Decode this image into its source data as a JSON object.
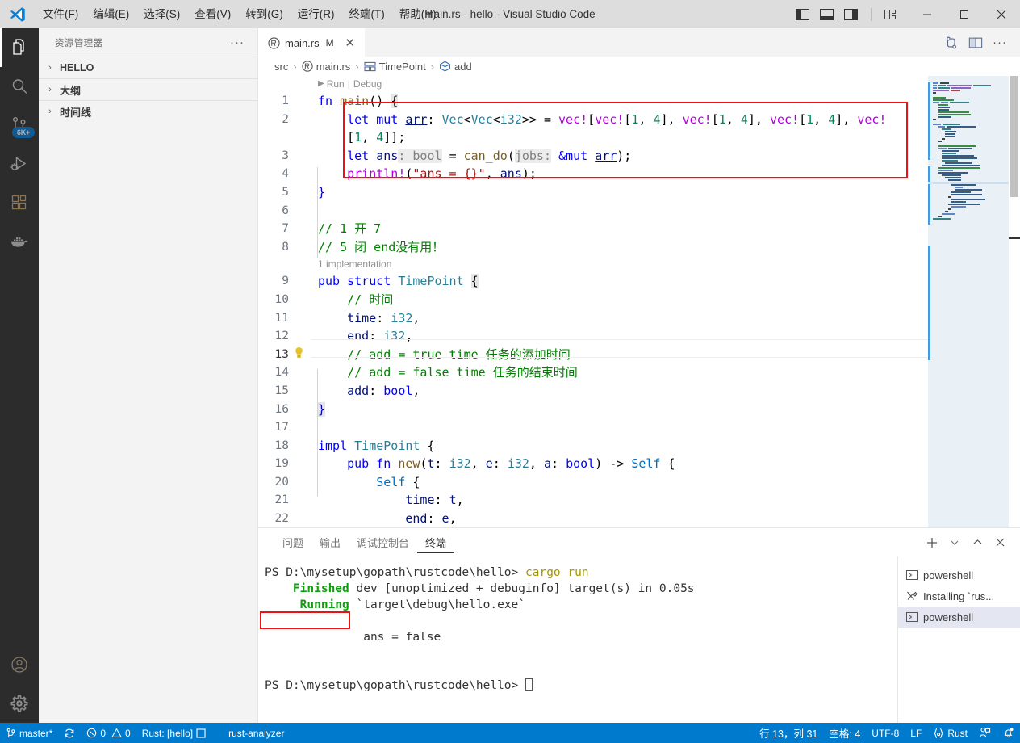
{
  "window": {
    "title": "main.rs - hello - Visual Studio Code",
    "logo_icon": "vscode-logo-icon",
    "menu": [
      {
        "label": "文件(F)",
        "name": "menu-file"
      },
      {
        "label": "编辑(E)",
        "name": "menu-edit"
      },
      {
        "label": "选择(S)",
        "name": "menu-selection"
      },
      {
        "label": "查看(V)",
        "name": "menu-view"
      },
      {
        "label": "转到(G)",
        "name": "menu-go"
      },
      {
        "label": "运行(R)",
        "name": "menu-run"
      },
      {
        "label": "终端(T)",
        "name": "menu-terminal"
      },
      {
        "label": "帮助(H)",
        "name": "menu-help"
      }
    ],
    "layout_buttons": [
      {
        "name": "toggle-primary-sidebar-icon",
        "title": "切换主侧栏"
      },
      {
        "name": "toggle-panel-icon",
        "title": "切换面板"
      },
      {
        "name": "toggle-secondary-sidebar-icon",
        "title": "切换辅助侧栏"
      },
      {
        "name": "customize-layout-icon",
        "title": "自定义布局"
      }
    ],
    "controls": [
      {
        "name": "minimize-button",
        "glyph": "—"
      },
      {
        "name": "maximize-button",
        "glyph": "□"
      },
      {
        "name": "close-button",
        "glyph": "✕"
      }
    ]
  },
  "activitybar": {
    "items": [
      {
        "name": "activity-explorer",
        "icon": "files-icon",
        "active": true,
        "badge": ""
      },
      {
        "name": "activity-search",
        "icon": "search-icon",
        "active": false,
        "badge": ""
      },
      {
        "name": "activity-source-control",
        "icon": "source-control-icon",
        "active": false,
        "badge": "6K+"
      },
      {
        "name": "activity-run-debug",
        "icon": "run-debug-icon",
        "active": false,
        "badge": ""
      },
      {
        "name": "activity-extensions",
        "icon": "extensions-icon",
        "active": false,
        "badge": ""
      },
      {
        "name": "activity-docker",
        "icon": "docker-icon",
        "active": false,
        "badge": ""
      }
    ],
    "bottom": [
      {
        "name": "activity-accounts",
        "icon": "account-icon"
      },
      {
        "name": "activity-settings",
        "icon": "gear-icon"
      }
    ]
  },
  "sidebar": {
    "title": "资源管理器",
    "more_label": "···",
    "sections": [
      {
        "name": "sidebar-section-hello",
        "label": "HELLO",
        "chevron": "›",
        "expanded": false
      },
      {
        "name": "sidebar-section-outline",
        "label": "大纲",
        "chevron": "›",
        "expanded": false
      },
      {
        "name": "sidebar-section-timeline",
        "label": "时间线",
        "chevron": "›",
        "expanded": false
      }
    ]
  },
  "tabs": {
    "items": [
      {
        "name": "tab-main-rs",
        "label": "main.rs",
        "modified": "M",
        "close": "✕",
        "icon": "rust-file-icon",
        "active": true
      }
    ],
    "actions": [
      {
        "name": "source-control-graph-icon"
      },
      {
        "name": "split-editor-icon"
      },
      {
        "name": "more-actions-icon",
        "glyph": "···"
      }
    ]
  },
  "breadcrumb": {
    "items": [
      {
        "name": "breadcrumb-src",
        "label": "src",
        "icon": ""
      },
      {
        "name": "breadcrumb-main-rs",
        "label": "main.rs",
        "icon": "rust-file-icon"
      },
      {
        "name": "breadcrumb-timepoint",
        "label": "TimePoint",
        "icon": "struct-icon"
      },
      {
        "name": "breadcrumb-add",
        "label": "add",
        "icon": "field-icon"
      }
    ],
    "separator": "›"
  },
  "editor": {
    "codelens": {
      "run": "Run",
      "sep": "|",
      "debug": "Debug",
      "triangle": "▶"
    },
    "implementation_lens": "1 implementation",
    "lightbulb_line": 13,
    "lines": [
      {
        "n": 1,
        "text": "fn main() {"
      },
      {
        "n": 2,
        "text": "    let mut arr: Vec<Vec<i32>> = vec![vec![1, 4], vec![1, 4], vec![1, 4], vec!"
      },
      {
        "n": "",
        "text": "    [1, 4]];"
      },
      {
        "n": 3,
        "text": "    let ans: bool = can_do(jobs: &mut arr);"
      },
      {
        "n": 4,
        "text": "    println!(\"ans = {}\", ans);"
      },
      {
        "n": 5,
        "text": "}"
      },
      {
        "n": 6,
        "text": ""
      },
      {
        "n": 7,
        "text": "// 1 开 7"
      },
      {
        "n": 8,
        "text": "// 5 闭 end没有用！"
      },
      {
        "n": 9,
        "text": "pub struct TimePoint {"
      },
      {
        "n": 10,
        "text": "    // 时间"
      },
      {
        "n": 11,
        "text": "    time: i32,"
      },
      {
        "n": 12,
        "text": "    end: i32,"
      },
      {
        "n": 13,
        "text": "    // add = true time 任务的添加时间"
      },
      {
        "n": 14,
        "text": "    // add = false time 任务的结束时间"
      },
      {
        "n": 15,
        "text": "    add: bool,"
      },
      {
        "n": 16,
        "text": "}"
      },
      {
        "n": 17,
        "text": ""
      },
      {
        "n": 18,
        "text": "impl TimePoint {"
      },
      {
        "n": 19,
        "text": "    pub fn new(t: i32, e: i32, a: bool) -> Self {"
      },
      {
        "n": 20,
        "text": "        Self {"
      },
      {
        "n": 21,
        "text": "            time: t,"
      },
      {
        "n": 22,
        "text": "            end: e,"
      }
    ]
  },
  "panel": {
    "tabs": [
      {
        "name": "panel-tab-problems",
        "label": "问题",
        "active": false
      },
      {
        "name": "panel-tab-output",
        "label": "输出",
        "active": false
      },
      {
        "name": "panel-tab-debug-console",
        "label": "调试控制台",
        "active": false
      },
      {
        "name": "panel-tab-terminal",
        "label": "终端",
        "active": true
      }
    ],
    "actions": [
      {
        "name": "new-terminal-button",
        "glyph": "+"
      },
      {
        "name": "terminal-profile-chevron-icon",
        "glyph": "∨"
      },
      {
        "name": "maximize-panel-icon",
        "glyph": "∧"
      },
      {
        "name": "close-panel-icon",
        "glyph": "✕"
      }
    ],
    "terminal": {
      "prompt": "PS D:\\mysetup\\gopath\\rustcode\\hello>",
      "command": "cargo run",
      "lines": [
        {
          "label": "Finished",
          "rest": " dev [unoptimized + debuginfo] target(s) in 0.05s"
        },
        {
          "label": "Running",
          "rest": " `target\\debug\\hello.exe`"
        }
      ],
      "program_output": "ans = false",
      "prompt2": "PS D:\\mysetup\\gopath\\rustcode\\hello>"
    },
    "terminal_list": [
      {
        "name": "terminal-list-item-powershell-1",
        "label": "powershell",
        "icon": "terminal-icon",
        "active": false
      },
      {
        "name": "terminal-list-item-installing",
        "label": "Installing `rus...",
        "icon": "tools-icon",
        "active": false
      },
      {
        "name": "terminal-list-item-powershell-2",
        "label": "powershell",
        "icon": "terminal-icon",
        "active": true
      }
    ]
  },
  "statusbar": {
    "left": [
      {
        "name": "status-branch",
        "icon": "source-control-icon",
        "label": "master*"
      },
      {
        "name": "status-sync",
        "icon": "sync-icon",
        "label": ""
      },
      {
        "name": "status-problems",
        "icon": "error-warning-icon",
        "label": "0  0",
        "errors": "0",
        "warnings": "0"
      },
      {
        "name": "status-rust-project",
        "icon": "",
        "label": "Rust: [hello]",
        "trailing_icon": "square-icon"
      },
      {
        "name": "status-rust-analyzer",
        "icon": "",
        "label": "rust-analyzer"
      }
    ],
    "right": [
      {
        "name": "status-cursor-position",
        "label": "行 13，列 31"
      },
      {
        "name": "status-indentation",
        "label": "空格: 4"
      },
      {
        "name": "status-encoding",
        "label": "UTF-8"
      },
      {
        "name": "status-eol",
        "label": "LF"
      },
      {
        "name": "status-language-mode",
        "label": "Rust",
        "icon": "braces-icon"
      },
      {
        "name": "status-feedback",
        "icon": "feedback-icon",
        "label": ""
      },
      {
        "name": "status-notifications",
        "icon": "bell-dot-icon",
        "label": ""
      }
    ]
  },
  "colors": {
    "accent": "#007acc",
    "annotation_red": "#ee1111",
    "badge_blue": "#0078d4",
    "terminal_green": "#0d9f0d",
    "terminal_yellow": "#a79500"
  }
}
